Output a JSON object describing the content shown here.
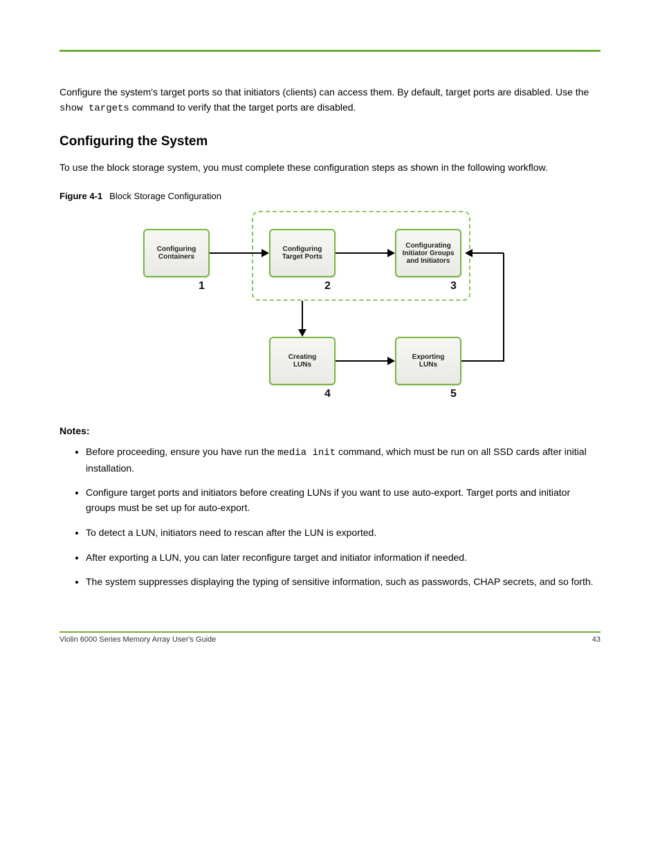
{
  "intro": {
    "p1_a": "Configure the system's target ports so that initiators (clients) can access them. By default, target ports are disabled. Use the ",
    "code1": "show targets",
    "p1_b": " command to verify that the target ports are disabled.",
    "p2": "To use the block storage system, you must complete these configuration steps as shown in the following workflow.",
    "heading": "Configuring the System",
    "fig_label": "Figure 4-1",
    "fig_title": "Block Storage Configuration"
  },
  "diagram": {
    "box1": "Configuring\nContainers",
    "box2": "Configuring\nTarget Ports",
    "box3": "Configurating\nInitiator Groups\nand Initiators",
    "box4": "Creating\nLUNs",
    "box5": "Exporting\nLUNs",
    "n1": "1",
    "n2": "2",
    "n3": "3",
    "n4": "4",
    "n5": "5"
  },
  "notes": {
    "heading": "Notes:",
    "b1_a": "Before proceeding, ensure you have run the ",
    "b1_code": "media init",
    "b1_b": " command, which must be run on all SSD cards after initial installation.",
    "b2": "Configure target ports and initiators before creating LUNs if you want to use auto-export. Target ports and initiator groups must be set up for auto-export.",
    "b3": "To detect a LUN, initiators need to rescan after the LUN is exported.",
    "b4": "After exporting a LUN, you can later reconfigure target and initiator information if needed.",
    "b5": "The system suppresses displaying the typing of sensitive information, such as passwords, CHAP secrets, and so forth."
  },
  "footer": {
    "left": "Violin 6000 Series Memory Array User's Guide",
    "right": "43"
  }
}
